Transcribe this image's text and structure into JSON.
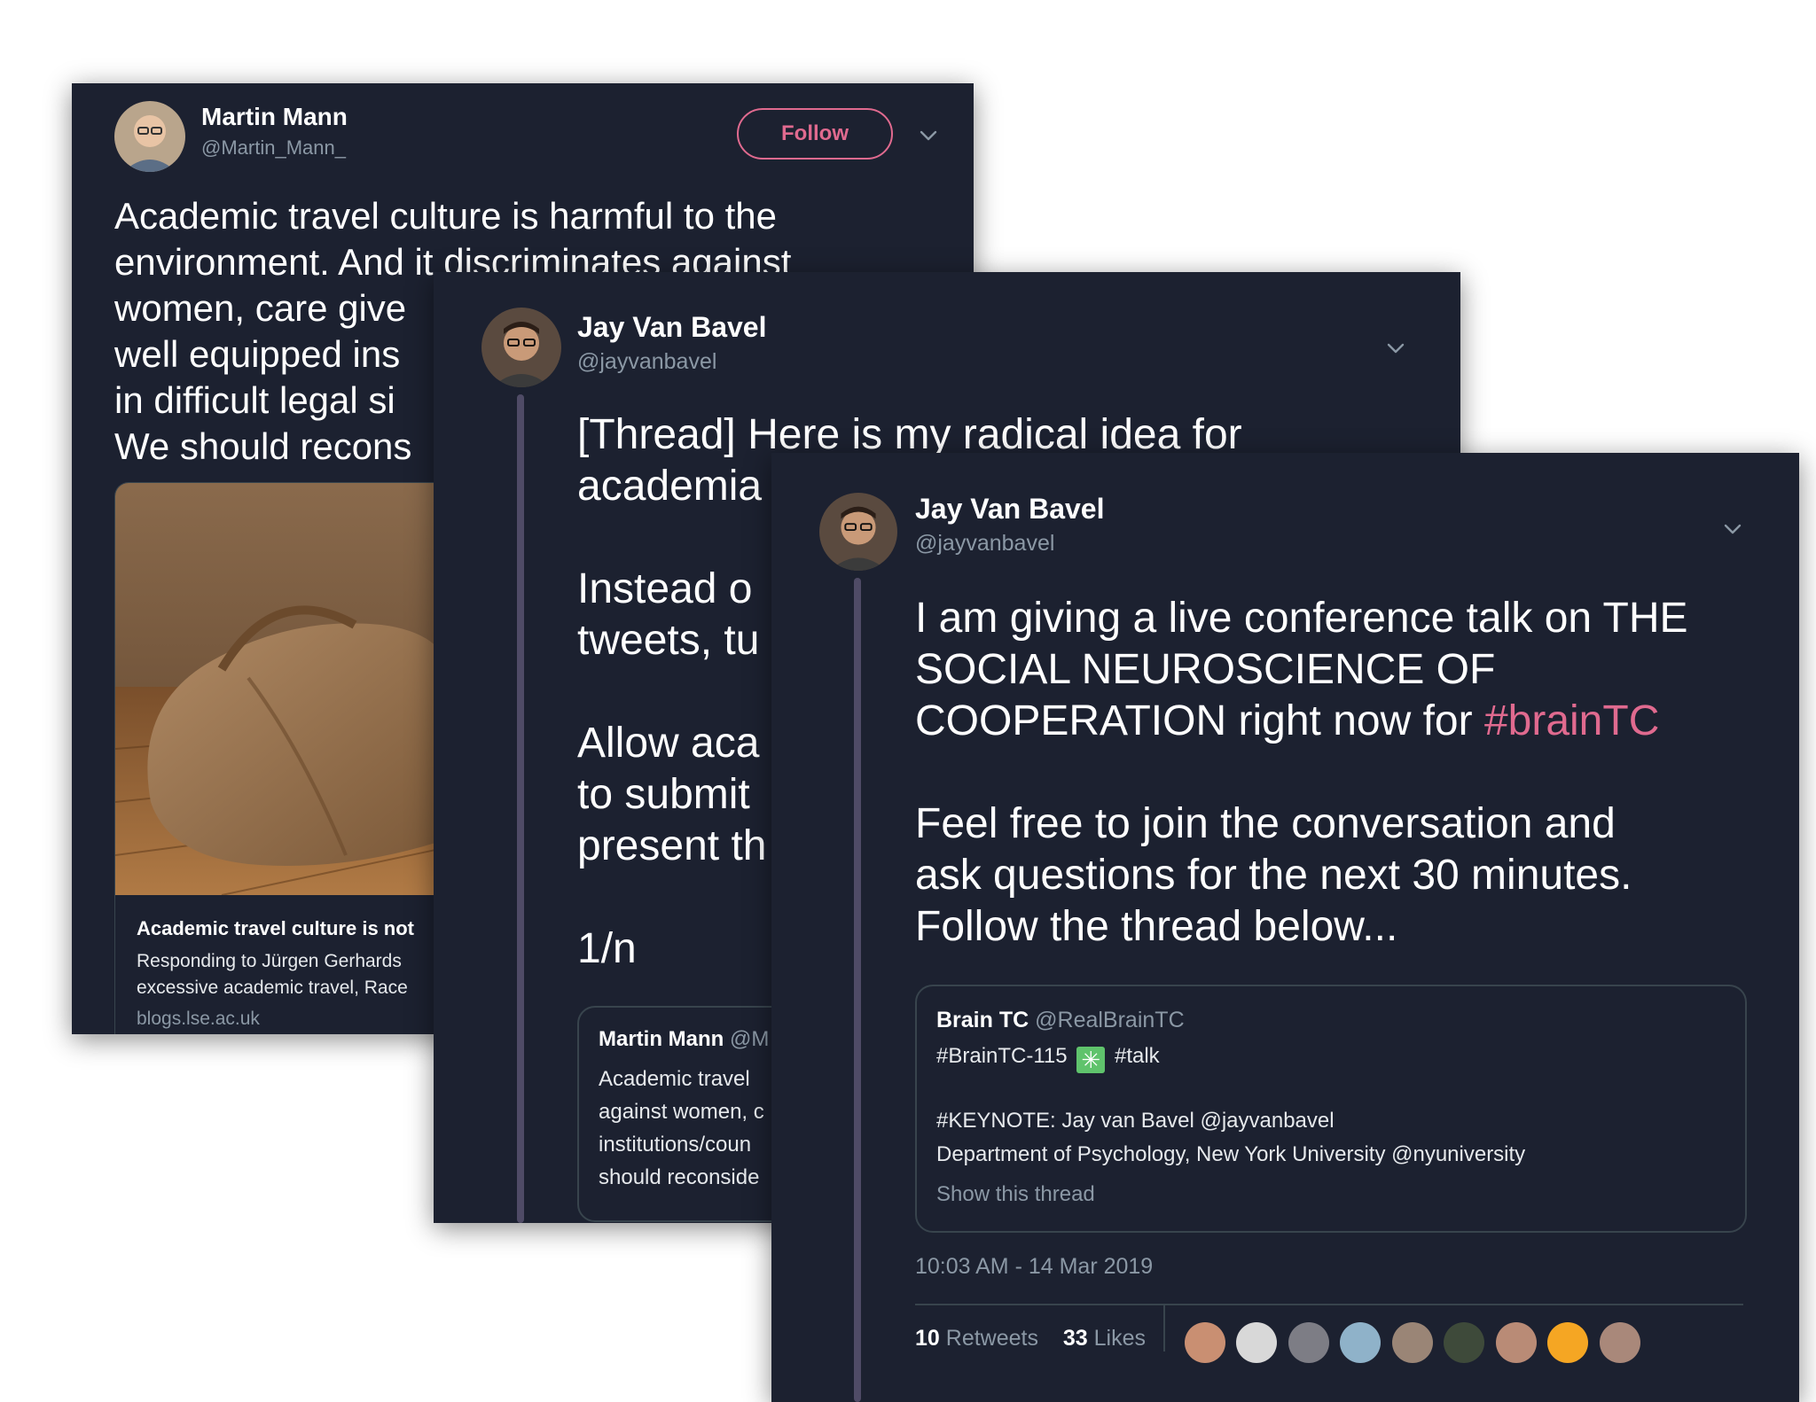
{
  "tweet1": {
    "name": "Martin Mann",
    "handle": "@Martin_Mann_",
    "follow_label": "Follow",
    "lines": [
      "Academic travel culture is harmful to the",
      "environment. And it discriminates against",
      "women, care give",
      "well equipped ins",
      "in difficult legal si",
      "We should recons"
    ],
    "link_title": "Academic travel culture is not",
    "link_desc_1": "Responding to Jürgen Gerhards",
    "link_desc_2": "excessive academic travel, Race",
    "link_domain": "blogs.lse.ac.uk"
  },
  "tweet2": {
    "name": "Jay Van Bavel",
    "handle": "@jayvanbavel",
    "para1": [
      "[Thread] Here is my radical idea for",
      "academia"
    ],
    "para2": [
      "Instead o",
      "tweets, tu"
    ],
    "para3": [
      "Allow aca",
      "to submit",
      "present th"
    ],
    "para4": "1/n",
    "quote_name": "Martin Mann",
    "quote_handle": "@M",
    "quote_lines": [
      "Academic travel",
      "against women, c",
      "institutions/coun",
      "should reconside"
    ]
  },
  "tweet3": {
    "name": "Jay Van Bavel",
    "handle": "@jayvanbavel",
    "text_lines_a": [
      "I am giving a live conference talk on THE",
      "SOCIAL NEUROSCIENCE OF",
      "COOPERATION right now for "
    ],
    "hashtag": "#brainTC",
    "text_lines_b": [
      "Feel free to join the conversation and",
      "ask questions for the next 30 minutes.",
      "Follow the thread below..."
    ],
    "quote": {
      "name": "Brain TC",
      "handle": "@RealBrainTC",
      "line1_a": "#BrainTC-115",
      "line1_b": "#talk",
      "line2": "#KEYNOTE: Jay van Bavel @jayvanbavel",
      "line3": "Department of Psychology, New York University @nyuniversity",
      "show_thread": "Show this thread"
    },
    "timestamp": "10:03 AM - 14 Mar 2019",
    "retweets_count": "10",
    "retweets_label": "Retweets",
    "likes_count": "33",
    "likes_label": "Likes"
  },
  "colors": {
    "card_bg": "#1c2130",
    "accent_pink": "#e06a8f",
    "gray_text": "#8b98a5",
    "thread_line": "#4f4b66"
  }
}
